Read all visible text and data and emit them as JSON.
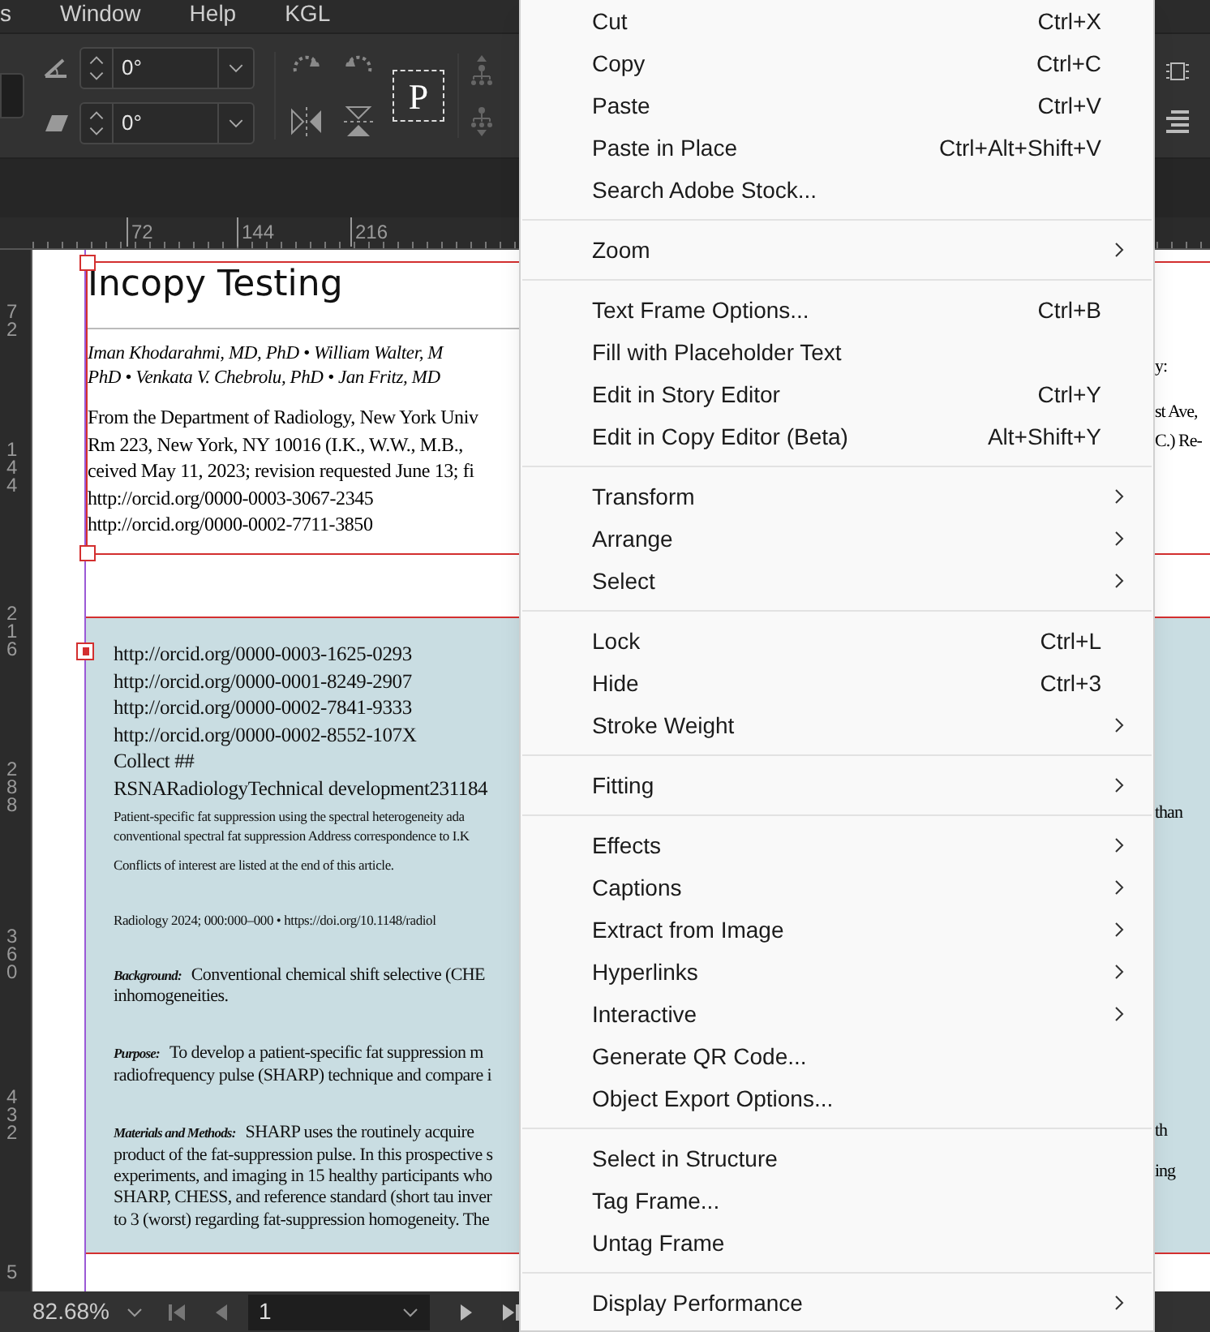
{
  "menu_bar": {
    "items": [
      "s",
      "Window",
      "Help",
      "KGL"
    ]
  },
  "toolbar": {
    "rotate_angle": "0°",
    "shear_angle": "0°",
    "proxy_label": "P"
  },
  "horizontal_ruler": {
    "labels": [
      "72",
      "144",
      "216"
    ]
  },
  "vertical_ruler": {
    "labels": [
      "72",
      "144",
      "216",
      "288",
      "360",
      "432",
      "5"
    ]
  },
  "title_frame": {
    "title": "Incopy Testing",
    "authors": [
      "Iman Khodarahmi, MD, PhD • William Walter, M",
      "PhD • Venkata V. Chebrolu, PhD • Jan Fritz, MD"
    ],
    "lines": [
      "From the Department of Radiology, New York Univ",
      "Rm 223, New York, NY 10016 (I.K., W.W., M.B.,",
      "ceived May 11, 2023; revision requested June 13; fi",
      "http://orcid.org/0000-0003-3067-2345",
      "http://orcid.org/0000-0002-7711-3850"
    ]
  },
  "story_frame": {
    "lines": [
      {
        "kind": "normal",
        "text": "http://orcid.org/0000-0003-1625-0293"
      },
      {
        "kind": "normal",
        "text": "http://orcid.org/0000-0001-8249-2907"
      },
      {
        "kind": "normal",
        "text": "http://orcid.org/0000-0002-7841-9333"
      },
      {
        "kind": "normal",
        "text": "http://orcid.org/0000-0002-8552-107X"
      },
      {
        "kind": "normal",
        "text": "Collect ##"
      },
      {
        "kind": "normal",
        "text": "RSNARadiologyTechnical development231184"
      },
      {
        "kind": "small",
        "text": "Patient-specific fat suppression using the spectral heterogeneity ada"
      },
      {
        "kind": "small",
        "text": "conventional spectral fat suppression Address correspondence to I.K"
      },
      {
        "kind": "small",
        "text": "Conflicts of interest are listed at the end of this article."
      },
      {
        "kind": "small",
        "text": "Radiology 2024; 000:000–000 • https://doi.org/10.1148/radiol"
      },
      {
        "kind": "abstract",
        "lead": "Background:",
        "text": "Conventional chemical shift selective (CHE",
        "more": [
          "inhomogeneities."
        ]
      },
      {
        "kind": "abstract",
        "lead": "Purpose:",
        "text": "To develop a patient-specific fat suppression m",
        "more": [
          "radiofrequency pulse (SHARP) technique and compare i"
        ]
      },
      {
        "kind": "abstract",
        "lead": "Materials and Methods:",
        "text": "SHARP uses the routinely acquire",
        "more": [
          "product of the fat-suppression pulse. In this prospective s",
          "experiments, and imaging in 15 healthy participants who",
          "SHARP, CHESS, and reference standard (short tau inver",
          "to 3 (worst) regarding fat-suppression homogeneity. The"
        ]
      }
    ]
  },
  "right_fragments": [
    "y:",
    "st Ave,",
    "C.) Re-",
    "than",
    "th",
    "ing"
  ],
  "status_bar": {
    "zoom": "82.68%",
    "page": "1"
  },
  "context_menu": {
    "groups": [
      [
        {
          "label": "Cut",
          "shortcut": "Ctrl+X",
          "submenu": false
        },
        {
          "label": "Copy",
          "shortcut": "Ctrl+C",
          "submenu": false
        },
        {
          "label": "Paste",
          "shortcut": "Ctrl+V",
          "submenu": false
        },
        {
          "label": "Paste in Place",
          "shortcut": "Ctrl+Alt+Shift+V",
          "submenu": false
        },
        {
          "label": "Search Adobe Stock...",
          "submenu": false
        }
      ],
      [
        {
          "label": "Zoom",
          "submenu": true
        }
      ],
      [
        {
          "label": "Text Frame Options...",
          "shortcut": "Ctrl+B",
          "submenu": false
        },
        {
          "label": "Fill with Placeholder Text",
          "submenu": false
        },
        {
          "label": "Edit in Story Editor",
          "shortcut": "Ctrl+Y",
          "submenu": false
        },
        {
          "label": "Edit in Copy Editor (Beta)",
          "shortcut": "Alt+Shift+Y",
          "submenu": false
        }
      ],
      [
        {
          "label": "Transform",
          "submenu": true
        },
        {
          "label": "Arrange",
          "submenu": true
        },
        {
          "label": "Select",
          "submenu": true
        }
      ],
      [
        {
          "label": "Lock",
          "shortcut": "Ctrl+L",
          "submenu": false
        },
        {
          "label": "Hide",
          "shortcut": "Ctrl+3",
          "submenu": false
        },
        {
          "label": "Stroke Weight",
          "submenu": true
        }
      ],
      [
        {
          "label": "Fitting",
          "submenu": true
        }
      ],
      [
        {
          "label": "Effects",
          "submenu": true
        },
        {
          "label": "Captions",
          "submenu": true
        },
        {
          "label": "Extract from Image",
          "submenu": true
        },
        {
          "label": "Hyperlinks",
          "submenu": true
        },
        {
          "label": "Interactive",
          "submenu": true
        },
        {
          "label": "Generate QR Code...",
          "submenu": false
        },
        {
          "label": "Object Export Options...",
          "submenu": false
        }
      ],
      [
        {
          "label": "Select in Structure",
          "submenu": false
        },
        {
          "label": "Tag Frame...",
          "submenu": false
        },
        {
          "label": "Untag Frame",
          "submenu": false
        }
      ],
      [
        {
          "label": "Display Performance",
          "submenu": true
        }
      ]
    ]
  }
}
